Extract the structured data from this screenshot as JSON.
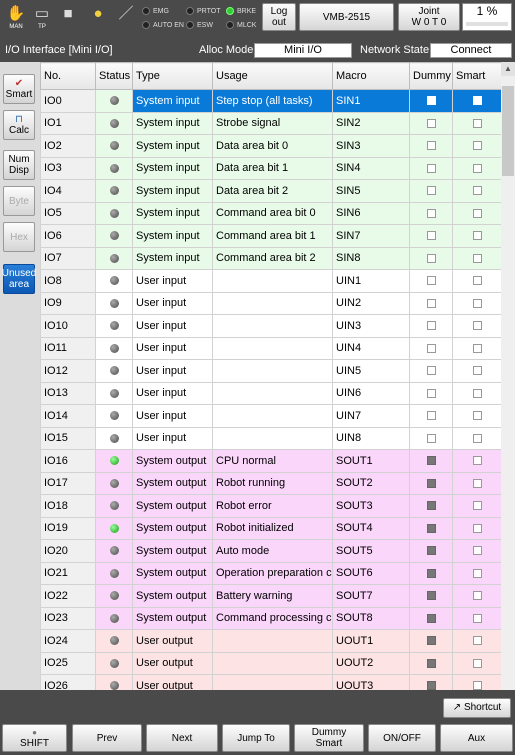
{
  "topbar": {
    "icons": [
      {
        "name": "man",
        "label": "MAN",
        "glyph": "✋"
      },
      {
        "name": "tp",
        "label": "TP",
        "glyph": "▭"
      },
      {
        "name": "stop",
        "label": "",
        "glyph": "■"
      },
      {
        "name": "lamp",
        "label": "",
        "glyph": "●"
      },
      {
        "name": "tool",
        "label": "",
        "glyph": "/"
      }
    ],
    "indicators": [
      {
        "label": "EMG",
        "on": false
      },
      {
        "label": "AUTO EN",
        "on": false
      },
      {
        "label": "PRTOT",
        "on": false
      },
      {
        "label": "ESW",
        "on": false
      },
      {
        "label": "BRKE",
        "on": true
      },
      {
        "label": "MLCK",
        "on": false
      }
    ],
    "logout": "Log out",
    "robot": "VMB-2515",
    "joint_line1": "Joint",
    "joint_line2": "W 0 T 0",
    "speed": "1 %"
  },
  "title": {
    "text": "I/O Interface [Mini I/O]",
    "alloc_label": "Alloc Mode",
    "alloc_value": "Mini I/O",
    "network_label": "Network State",
    "network_value": "Connect"
  },
  "side": {
    "smart": "Smart",
    "calc": "Calc",
    "numdisp1": "Num",
    "numdisp2": "Disp",
    "byte": "Byte",
    "hex": "Hex",
    "unused1": "Unused",
    "unused2": "area"
  },
  "table": {
    "headers": [
      "No.",
      "Status",
      "Type",
      "Usage",
      "Macro",
      "Dummy",
      "Smart"
    ],
    "rows": [
      {
        "no": "IO0",
        "on": false,
        "type": "System input",
        "usage": "Step stop (all tasks)",
        "macro": "SIN1",
        "dummy": false,
        "cls": "sys sel"
      },
      {
        "no": "IO1",
        "on": false,
        "type": "System input",
        "usage": "Strobe signal",
        "macro": "SIN2",
        "dummy": false,
        "cls": "sys"
      },
      {
        "no": "IO2",
        "on": false,
        "type": "System input",
        "usage": "Data area bit 0",
        "macro": "SIN3",
        "dummy": false,
        "cls": "sys"
      },
      {
        "no": "IO3",
        "on": false,
        "type": "System input",
        "usage": "Data area bit 1",
        "macro": "SIN4",
        "dummy": false,
        "cls": "sys"
      },
      {
        "no": "IO4",
        "on": false,
        "type": "System input",
        "usage": "Data area bit 2",
        "macro": "SIN5",
        "dummy": false,
        "cls": "sys"
      },
      {
        "no": "IO5",
        "on": false,
        "type": "System input",
        "usage": "Command area  bit 0",
        "macro": "SIN6",
        "dummy": false,
        "cls": "sys"
      },
      {
        "no": "IO6",
        "on": false,
        "type": "System input",
        "usage": "Command area  bit 1",
        "macro": "SIN7",
        "dummy": false,
        "cls": "sys"
      },
      {
        "no": "IO7",
        "on": false,
        "type": "System input",
        "usage": "Command area  bit 2",
        "macro": "SIN8",
        "dummy": false,
        "cls": "sys"
      },
      {
        "no": "IO8",
        "on": false,
        "type": "User input",
        "usage": "",
        "macro": "UIN1",
        "dummy": false,
        "cls": ""
      },
      {
        "no": "IO9",
        "on": false,
        "type": "User input",
        "usage": "",
        "macro": "UIN2",
        "dummy": false,
        "cls": ""
      },
      {
        "no": "IO10",
        "on": false,
        "type": "User input",
        "usage": "",
        "macro": "UIN3",
        "dummy": false,
        "cls": ""
      },
      {
        "no": "IO11",
        "on": false,
        "type": "User input",
        "usage": "",
        "macro": "UIN4",
        "dummy": false,
        "cls": ""
      },
      {
        "no": "IO12",
        "on": false,
        "type": "User input",
        "usage": "",
        "macro": "UIN5",
        "dummy": false,
        "cls": ""
      },
      {
        "no": "IO13",
        "on": false,
        "type": "User input",
        "usage": "",
        "macro": "UIN6",
        "dummy": false,
        "cls": ""
      },
      {
        "no": "IO14",
        "on": false,
        "type": "User input",
        "usage": "",
        "macro": "UIN7",
        "dummy": false,
        "cls": ""
      },
      {
        "no": "IO15",
        "on": false,
        "type": "User input",
        "usage": "",
        "macro": "UIN8",
        "dummy": false,
        "cls": ""
      },
      {
        "no": "IO16",
        "on": true,
        "type": "System output",
        "usage": "CPU normal",
        "macro": "SOUT1",
        "dummy": true,
        "cls": "sout"
      },
      {
        "no": "IO17",
        "on": false,
        "type": "System output",
        "usage": "Robot running",
        "macro": "SOUT2",
        "dummy": true,
        "cls": "sout"
      },
      {
        "no": "IO18",
        "on": false,
        "type": "System output",
        "usage": "Robot error",
        "macro": "SOUT3",
        "dummy": true,
        "cls": "sout"
      },
      {
        "no": "IO19",
        "on": true,
        "type": "System output",
        "usage": "Robot initialized",
        "macro": "SOUT4",
        "dummy": true,
        "cls": "sout"
      },
      {
        "no": "IO20",
        "on": false,
        "type": "System output",
        "usage": "Auto mode",
        "macro": "SOUT5",
        "dummy": true,
        "cls": "sout"
      },
      {
        "no": "IO21",
        "on": false,
        "type": "System output",
        "usage": "Operation preparation co",
        "macro": "SOUT6",
        "dummy": true,
        "cls": "sout"
      },
      {
        "no": "IO22",
        "on": false,
        "type": "System output",
        "usage": "Battery warning",
        "macro": "SOUT7",
        "dummy": true,
        "cls": "sout"
      },
      {
        "no": "IO23",
        "on": false,
        "type": "System output",
        "usage": "Command processing co",
        "macro": "SOUT8",
        "dummy": true,
        "cls": "sout"
      },
      {
        "no": "IO24",
        "on": false,
        "type": "User output",
        "usage": "",
        "macro": "UOUT1",
        "dummy": true,
        "cls": "uout"
      },
      {
        "no": "IO25",
        "on": false,
        "type": "User output",
        "usage": "",
        "macro": "UOUT2",
        "dummy": true,
        "cls": "uout"
      },
      {
        "no": "IO26",
        "on": false,
        "type": "User output",
        "usage": "",
        "macro": "UOUT3",
        "dummy": true,
        "cls": "uout"
      }
    ]
  },
  "bottom": {
    "shortcut": "Shortcut",
    "shift": "SHIFT",
    "prev": "Prev",
    "next": "Next",
    "jumpto": "Jump To",
    "dummy1": "Dummy",
    "dummy2": "Smart",
    "onoff": "ON/OFF",
    "aux": "Aux"
  }
}
